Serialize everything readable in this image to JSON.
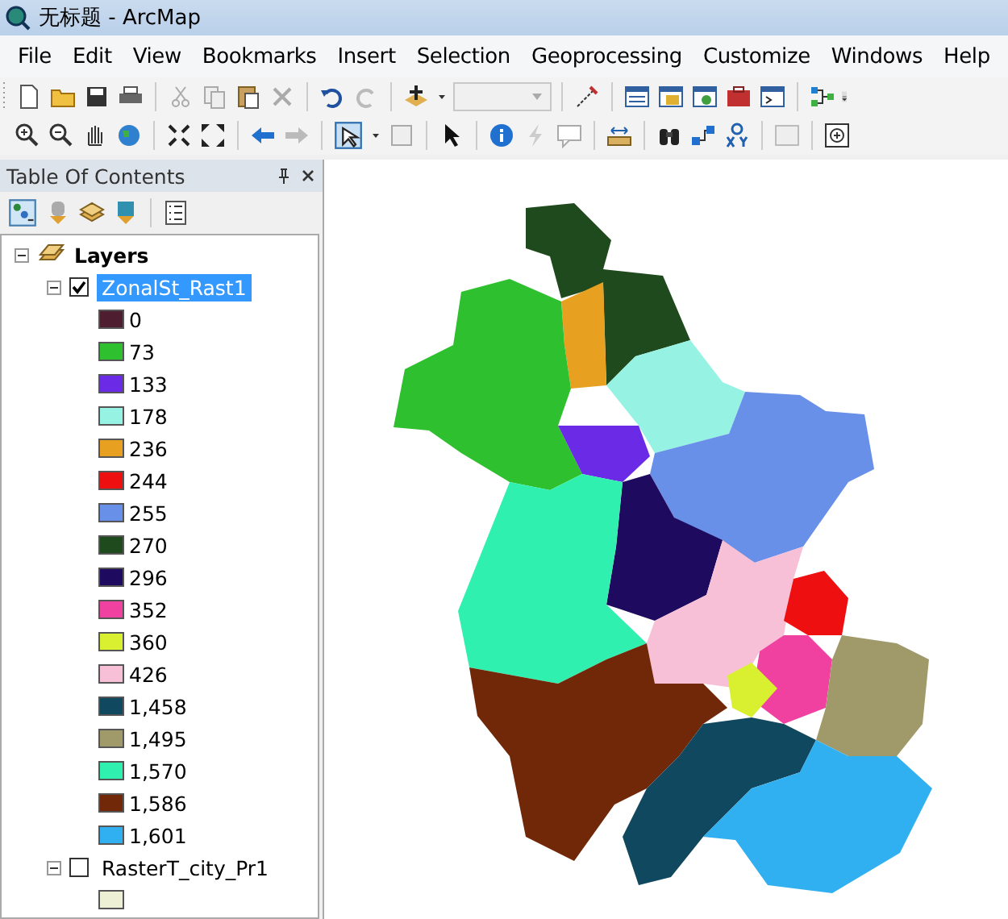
{
  "window": {
    "title": "无标题 - ArcMap"
  },
  "menu": [
    "File",
    "Edit",
    "View",
    "Bookmarks",
    "Insert",
    "Selection",
    "Geoprocessing",
    "Customize",
    "Windows",
    "Help"
  ],
  "toc": {
    "title": "Table Of Contents"
  },
  "layers": {
    "label": "Layers",
    "expanded": true,
    "children": [
      {
        "name": "ZonalSt_Rast1",
        "checked": true,
        "selected": true,
        "expanded": true,
        "legend": [
          {
            "label": "0",
            "color": "#4e1e30"
          },
          {
            "label": "73",
            "color": "#2ec02e"
          },
          {
            "label": "133",
            "color": "#6a2ae6"
          },
          {
            "label": "178",
            "color": "#96f2e2"
          },
          {
            "label": "236",
            "color": "#e8a020"
          },
          {
            "label": "244",
            "color": "#ee1010"
          },
          {
            "label": "255",
            "color": "#6890e8"
          },
          {
            "label": "270",
            "color": "#1e4a1e"
          },
          {
            "label": "296",
            "color": "#1e0a5e"
          },
          {
            "label": "352",
            "color": "#f040a0"
          },
          {
            "label": "360",
            "color": "#d8f030"
          },
          {
            "label": "426",
            "color": "#f8c0d6"
          },
          {
            "label": "1,458",
            "color": "#104860"
          },
          {
            "label": "1,495",
            "color": "#a09a6a"
          },
          {
            "label": "1,570",
            "color": "#30f0b0"
          },
          {
            "label": "1,586",
            "color": "#702808"
          },
          {
            "label": "1,601",
            "color": "#30b0f0"
          }
        ]
      },
      {
        "name": "RasterT_city_Pr1",
        "checked": false,
        "selected": false,
        "expanded": true,
        "legend": [
          {
            "color": "#eef0d6"
          }
        ]
      }
    ]
  }
}
